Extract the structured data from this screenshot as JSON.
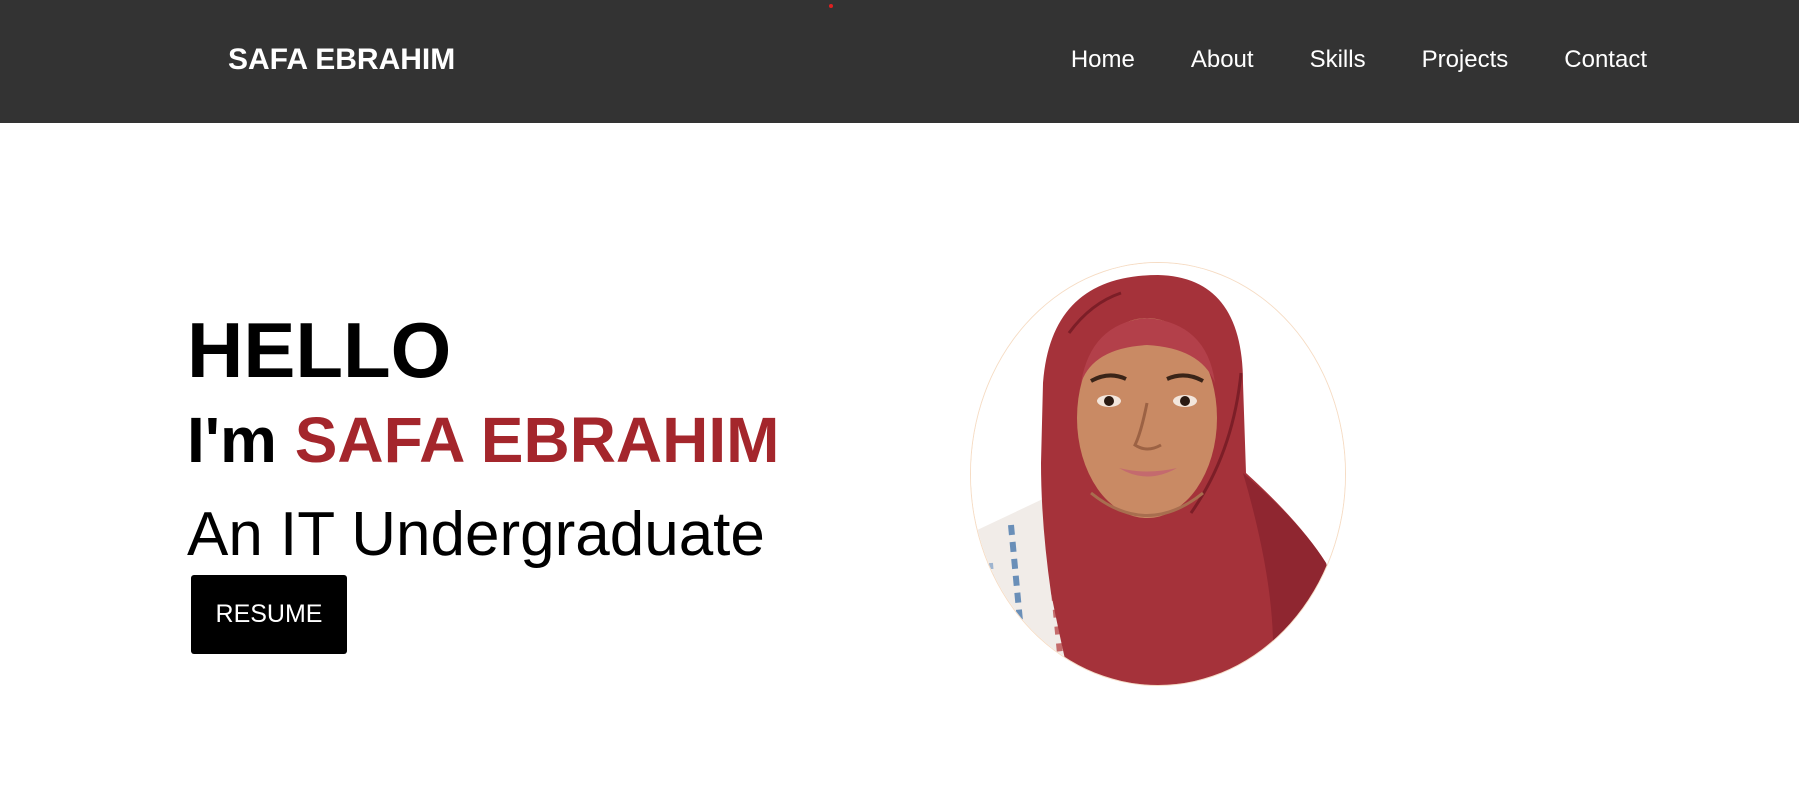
{
  "nav": {
    "brand": "SAFA EBRAHIM",
    "links": [
      {
        "label": "Home"
      },
      {
        "label": "About"
      },
      {
        "label": "Skills"
      },
      {
        "label": "Projects"
      },
      {
        "label": "Contact"
      }
    ]
  },
  "hero": {
    "greeting": "HELLO",
    "intro_prefix": "I'm",
    "name": "SAFA EBRAHIM",
    "role": "An IT Undergraduate",
    "resume_label": "RESUME"
  },
  "colors": {
    "nav_background": "#333333",
    "accent": "#a4262c",
    "button_background": "#000000"
  }
}
